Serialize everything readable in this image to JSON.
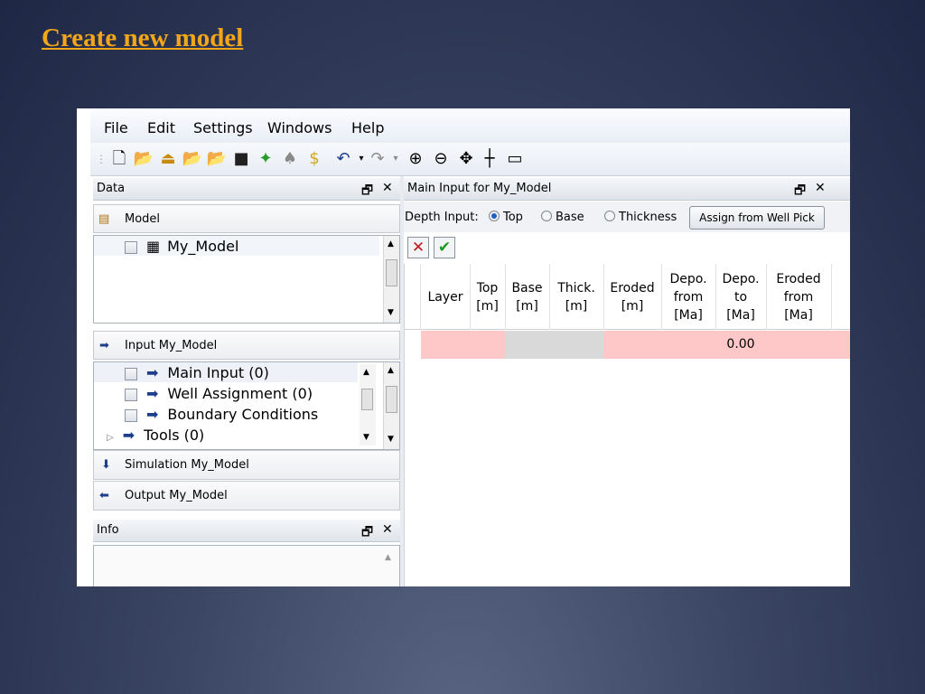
{
  "slide": {
    "title": "Create new model"
  },
  "menu": [
    "File",
    "Edit",
    "Settings",
    "Windows",
    "Help"
  ],
  "toolbar": {
    "icons": [
      "new-file-icon",
      "open-1d-icon",
      "import-icon",
      "open-2d-icon",
      "open-3d-icon",
      "save-icon",
      "run-icon",
      "simulate-icon",
      "calibrate-icon",
      "undo-icon",
      "redo-icon",
      "zoom-in-icon",
      "zoom-out-icon",
      "pan-icon",
      "crosshair-icon",
      "rectangle-icon"
    ]
  },
  "data_panel": {
    "title": "Data",
    "model_label": "Model",
    "model_item": "My_Model",
    "input_label": "Input My_Model",
    "input_items": [
      "Main Input (0)",
      "Well Assignment (0)",
      "Boundary Conditions",
      "Tools (0)"
    ],
    "simulation_label": "Simulation My_Model",
    "output_label": "Output My_Model"
  },
  "info_panel": {
    "title": "Info"
  },
  "main_panel": {
    "title": "Main Input for My_Model",
    "depth_label": "Depth Input:",
    "options": [
      "Top",
      "Base",
      "Thickness"
    ],
    "selected": "Top",
    "assign_button": "Assign from Well Pick",
    "columns": [
      [
        "Layer"
      ],
      [
        "Top",
        "[m]"
      ],
      [
        "Base",
        "[m]"
      ],
      [
        "Thick.",
        "[m]"
      ],
      [
        "Eroded",
        "[m]"
      ],
      [
        "Depo.",
        "from",
        "[Ma]"
      ],
      [
        "Depo.",
        "to",
        "[Ma]"
      ],
      [
        "Eroded",
        "from",
        "[Ma]"
      ]
    ],
    "row": {
      "depo_to": "0.00"
    }
  },
  "colors": {
    "row_pink": "#ffc8c8",
    "row_gray": "#d9d9d9",
    "title": "#f2a71b"
  }
}
